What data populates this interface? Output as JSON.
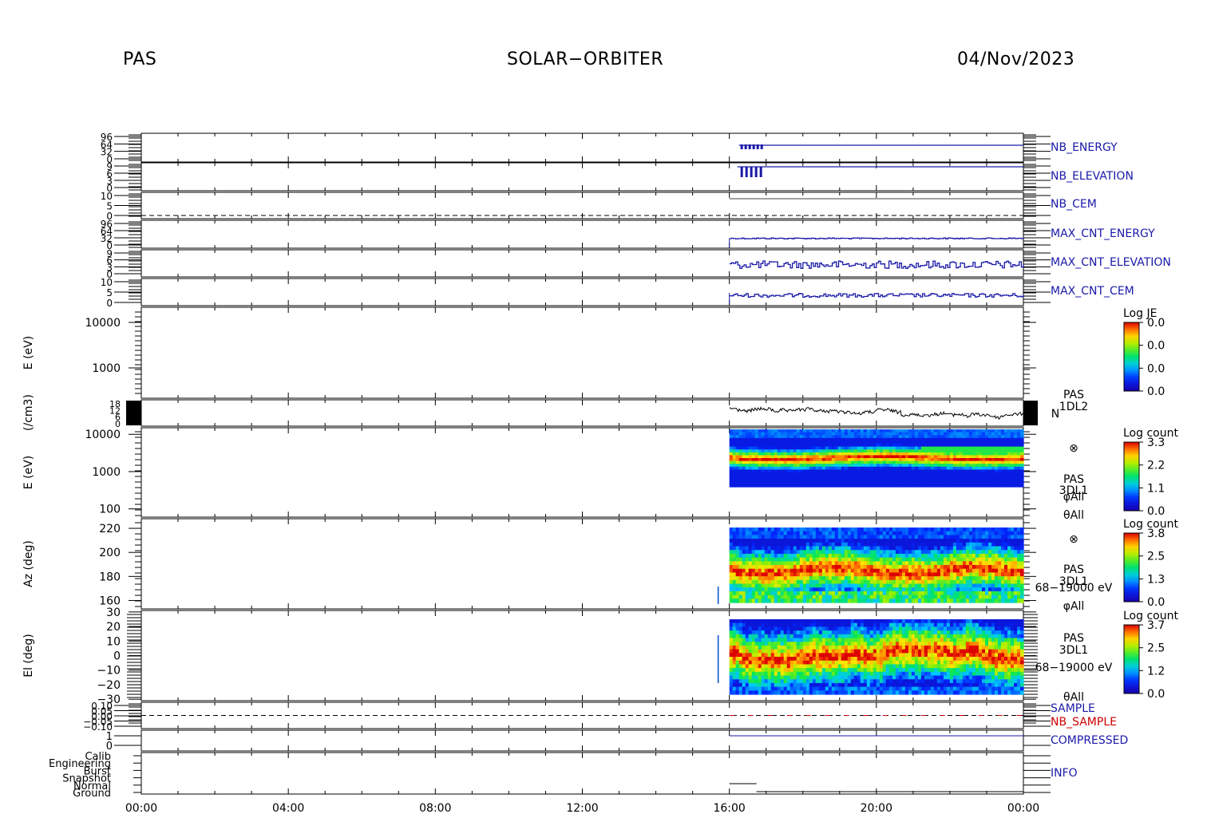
{
  "header": {
    "instrument": "PAS",
    "mission": "SOLAR−ORBITER",
    "date": "04/Nov/2023"
  },
  "colors": {
    "axis": "#000000",
    "status_line": "#1a1aa8",
    "label_blue": "#1a1aa8",
    "label_red": "#cc0000"
  },
  "chart_data": {
    "type": "heatmap",
    "x_ticks": [
      "00:00",
      "04:00",
      "08:00",
      "12:00",
      "16:00",
      "20:00",
      "00:00"
    ],
    "xlim_hours": [
      0,
      24
    ],
    "data_start_hours": 16.0,
    "panels": [
      {
        "name": "NB_ENERGY",
        "kind": "line",
        "label_color": "#1a1aa8",
        "y_ticks": [
          "96",
          "64",
          "32",
          "0"
        ]
      },
      {
        "name": "NB_ELEVATION",
        "kind": "line",
        "label_color": "#1a1aa8",
        "y_ticks": [
          "9",
          "6",
          "3",
          "0"
        ]
      },
      {
        "name": "NB_CEM",
        "kind": "line",
        "label_color": "#1a1aa8",
        "y_ticks": [
          "10",
          "5",
          "0"
        ]
      },
      {
        "name": "MAX_CNT_ENERGY",
        "kind": "line",
        "label_color": "#1a1aa8",
        "y_ticks": [
          "96",
          "64",
          "32",
          "0"
        ]
      },
      {
        "name": "MAX_CNT_ELEVATION",
        "kind": "line",
        "label_color": "#1a1aa8",
        "y_ticks": [
          "9",
          "6",
          "3",
          "0"
        ]
      },
      {
        "name": "MAX_CNT_CEM",
        "kind": "line",
        "label_color": "#1a1aa8",
        "y_ticks": [
          "10",
          "5",
          "0"
        ]
      },
      {
        "name": "1D energy spectrogram",
        "kind": "spectrogram_empty",
        "ylabel": "E (eV)",
        "y_ticks": [
          "10000",
          "1000"
        ],
        "colorbar": {
          "title": "Log JE",
          "ticks": [
            "0.0",
            "0.0",
            "0.0",
            "0.0"
          ]
        }
      },
      {
        "name": "density",
        "kind": "line",
        "ylabel": "(/cm3)",
        "y_ticks": [
          "18",
          "12",
          "6",
          "0"
        ],
        "side_labels": [
          "PAS",
          "1DL2",
          "N"
        ]
      },
      {
        "name": "3D energy spectrogram",
        "kind": "spectrogram",
        "ylabel": "E (eV)",
        "y_ticks": [
          "10000",
          "1000",
          "100"
        ],
        "ylim": [
          60,
          15000
        ],
        "scale": "log",
        "colorbar": {
          "title": "Log count",
          "ticks": [
            "3.3",
            "2.2",
            "1.1",
            "0.0"
          ]
        },
        "side_labels": [
          "⊗",
          "PAS",
          "3DL1",
          "φAll",
          "θAll"
        ]
      },
      {
        "name": "azimuth spectrogram",
        "kind": "spectrogram",
        "ylabel": "Az (deg)",
        "y_ticks": [
          "220",
          "200",
          "180",
          "160"
        ],
        "ylim": [
          153,
          228
        ],
        "scale": "linear",
        "colorbar": {
          "title": "Log count",
          "ticks": [
            "3.8",
            "2.5",
            "1.3",
            "0.0"
          ]
        },
        "side_labels": [
          "⊗",
          "PAS",
          "3DL1",
          "68−19000 eV",
          "φAll"
        ]
      },
      {
        "name": "elevation spectrogram",
        "kind": "spectrogram",
        "ylabel": "El (deg)",
        "y_ticks": [
          "30",
          "20",
          "10",
          "0",
          "−10",
          "−20",
          "−30"
        ],
        "ylim": [
          -31,
          31
        ],
        "scale": "linear",
        "colorbar": {
          "title": "Log count",
          "ticks": [
            "3.7",
            "2.5",
            "1.2",
            "0.0"
          ]
        },
        "side_labels": [
          "PAS",
          "3DL1",
          "68−19000 eV",
          "θAll"
        ]
      },
      {
        "name": "SAMPLE",
        "kind": "line",
        "label_color": "#1a1aa8",
        "second_label": "NB_SAMPLE",
        "second_label_color": "#cc0000",
        "y_ticks": [
          "0.10",
          "0.05",
          "0.00",
          "−0.05",
          "−0.10"
        ]
      },
      {
        "name": "COMPRESSED",
        "kind": "line",
        "label_color": "#1a1aa8",
        "y_ticks": [
          "1",
          "0"
        ]
      },
      {
        "name": "INFO",
        "kind": "categorical",
        "label_color": "#1a1aa8",
        "y_ticks": [
          "Calib",
          "Engineering",
          "Burst",
          "Snapshot",
          "Normal",
          "Ground"
        ]
      }
    ]
  }
}
